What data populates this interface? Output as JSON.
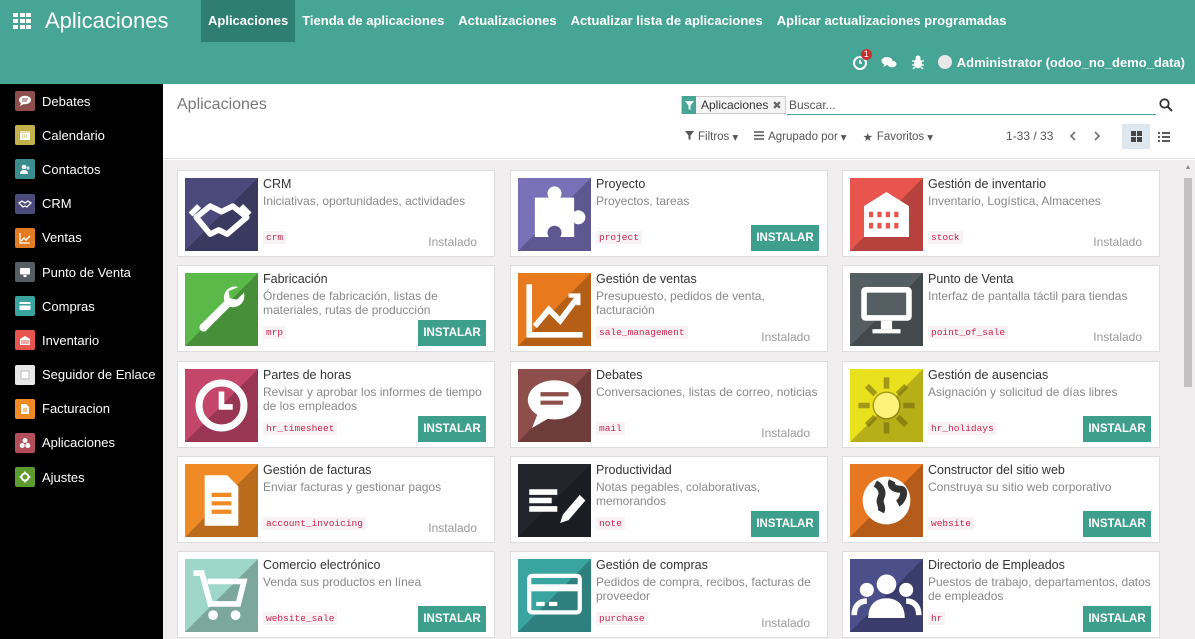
{
  "app_title": "Aplicaciones",
  "top_menu": [
    {
      "label": "Aplicaciones",
      "active": true
    },
    {
      "label": "Tienda de aplicaciones",
      "active": false
    },
    {
      "label": "Actualizaciones",
      "active": false
    },
    {
      "label": "Actualizar lista de aplicaciones",
      "active": false
    },
    {
      "label": "Aplicar actualizaciones programadas",
      "active": false
    }
  ],
  "systray": {
    "activity_count": "1",
    "user_label": "Administrator (odoo_no_demo_data)"
  },
  "sidebar": [
    {
      "label": "Debates",
      "icon": "chat-bubble-icon",
      "color": "#8e4e4c"
    },
    {
      "label": "Calendario",
      "icon": "calendar-icon",
      "color": "#c2b04c"
    },
    {
      "label": "Contactos",
      "icon": "contacts-icon",
      "color": "#3a8c8e"
    },
    {
      "label": "CRM",
      "icon": "handshake-icon",
      "color": "#4b4a7a"
    },
    {
      "label": "Ventas",
      "icon": "chart-line-icon",
      "color": "#e37b22"
    },
    {
      "label": "Punto de Venta",
      "icon": "monitor-icon",
      "color": "#555f63"
    },
    {
      "label": "Compras",
      "icon": "credit-card-icon",
      "color": "#3aa4a1"
    },
    {
      "label": "Inventario",
      "icon": "building-icon",
      "color": "#e8554e"
    },
    {
      "label": "Seguidor de Enlace",
      "icon": "link-tracker-icon",
      "color": "#e8e8e8"
    },
    {
      "label": "Facturacion",
      "icon": "invoice-icon",
      "color": "#f08a24"
    },
    {
      "label": "Aplicaciones",
      "icon": "apps-cubes-icon",
      "color": "#b24e5a"
    },
    {
      "label": "Ajustes",
      "icon": "gears-icon",
      "color": "#5d9b30"
    }
  ],
  "control_panel": {
    "breadcrumb": "Aplicaciones",
    "facet_label": "Aplicaciones",
    "search_placeholder": "Buscar...",
    "filters_label": "Filtros",
    "group_by_label": "Agrupado por",
    "favorites_label": "Favoritos",
    "pager": "1-33 / 33"
  },
  "apps": [
    {
      "name": "CRM",
      "summary": "Iniciativas, oportunidades, actividades",
      "technical": "crm",
      "state": "installed",
      "icon": "handshake-icon",
      "color": "#4b4a7a"
    },
    {
      "name": "Proyecto",
      "summary": "Proyectos, tareas",
      "technical": "project",
      "state": "install",
      "icon": "puzzle-icon",
      "color": "#7a70b8"
    },
    {
      "name": "Gestión de inventario",
      "summary": "Inventario, Logística, Almacenes",
      "technical": "stock",
      "state": "installed",
      "icon": "building-icon",
      "color": "#e8554e"
    },
    {
      "name": "Fabricación",
      "summary": "Órdenes de fabricación, listas de materiales, rutas de producción",
      "technical": "mrp",
      "state": "install",
      "icon": "wrench-icon",
      "color": "#5bb94a"
    },
    {
      "name": "Gestión de ventas",
      "summary": "Presupuesto, pedidos de venta, facturación",
      "technical": "sale_management",
      "state": "installed",
      "icon": "chart-line-icon",
      "color": "#e8791d"
    },
    {
      "name": "Punto de Venta",
      "summary": "Interfaz de pantalla táctil para tiendas",
      "technical": "point_of_sale",
      "state": "installed",
      "icon": "monitor-icon",
      "color": "#555f63"
    },
    {
      "name": "Partes de horas",
      "summary": "Revisar y aprobar los informes de tiempo de los empleados",
      "technical": "hr_timesheet",
      "state": "install",
      "icon": "clock-icon",
      "color": "#c4466b"
    },
    {
      "name": "Debates",
      "summary": "Conversaciones, listas de correo, noticias",
      "technical": "mail",
      "state": "installed",
      "icon": "chat-bubble-icon",
      "color": "#8e4e4c"
    },
    {
      "name": "Gestión de ausencias",
      "summary": "Asignación y solicitud de días libres",
      "technical": "hr_holidays",
      "state": "install",
      "icon": "sun-icon",
      "color": "#e9e01e"
    },
    {
      "name": "Gestión de facturas",
      "summary": "Enviar facturas y gestionar pagos",
      "technical": "account_invoicing",
      "state": "installed",
      "icon": "invoice-icon",
      "color": "#f08a24"
    },
    {
      "name": "Productividad",
      "summary": "Notas pegables, colaborativas, memorandos",
      "technical": "note",
      "state": "install",
      "icon": "pencil-note-icon",
      "color": "#22262c"
    },
    {
      "name": "Constructor del sitio web",
      "summary": "Construya su sitio web corporativo",
      "technical": "website",
      "state": "install",
      "icon": "globe-icon",
      "color": "#e87722"
    },
    {
      "name": "Comercio electrónico",
      "summary": "Venda sus productos en línea",
      "technical": "website_sale",
      "state": "install",
      "icon": "shopping-cart-icon",
      "color": "#9ed6c9"
    },
    {
      "name": "Gestión de compras",
      "summary": "Pedidos de compra, recibos, facturas de proveedor",
      "technical": "purchase",
      "state": "installed",
      "icon": "credit-card-icon",
      "color": "#3aa4a1"
    },
    {
      "name": "Directorio de Empleados",
      "summary": "Puestos de trabajo, departamentos, datos de empleados",
      "technical": "hr",
      "state": "install",
      "icon": "users-icon",
      "color": "#4b4f8a"
    }
  ],
  "labels": {
    "installed": "Instalado",
    "install": "INSTALAR"
  }
}
